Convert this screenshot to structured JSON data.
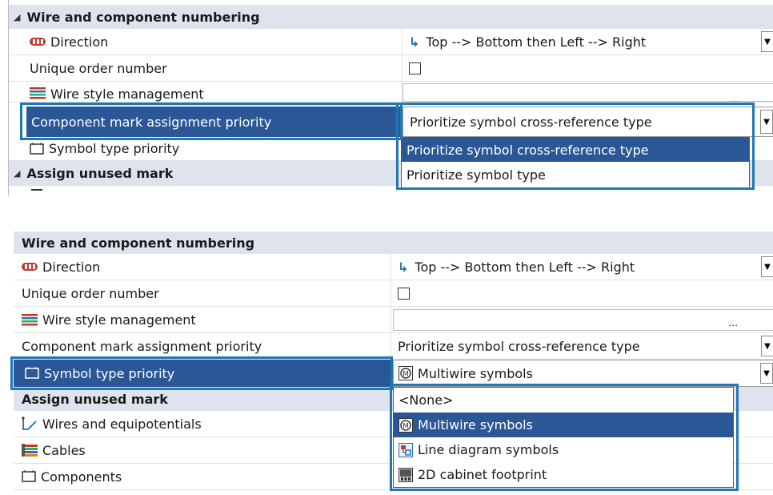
{
  "panel1": {
    "header": "Wire and component numbering",
    "rows": {
      "direction": {
        "label": "Direction",
        "value": "Top --> Bottom then Left --> Right"
      },
      "unique_order": {
        "label": "Unique order number"
      },
      "wire_style": {
        "label": "Wire style management",
        "button": "..."
      },
      "component_mark": {
        "label": "Component mark assignment priority",
        "value": "Prioritize symbol cross-reference type"
      },
      "symbol_type": {
        "label": "Symbol type priority"
      }
    },
    "header2": "Assign unused mark",
    "dropdown_options": [
      "Prioritize symbol cross-reference type",
      "Prioritize symbol type"
    ]
  },
  "panel2": {
    "header": "Wire and component numbering",
    "rows": {
      "direction": {
        "label": "Direction",
        "value": "Top --> Bottom then Left --> Right"
      },
      "unique_order": {
        "label": "Unique order number"
      },
      "wire_style": {
        "label": "Wire style management",
        "button": "..."
      },
      "component_mark": {
        "label": "Component mark assignment priority",
        "value": "Prioritize symbol cross-reference type"
      },
      "symbol_type": {
        "label": "Symbol type priority",
        "value": "Multiwire symbols"
      }
    },
    "header2": "Assign unused mark",
    "sub_rows": [
      "Wires and equipotentials",
      "Cables",
      "Components"
    ],
    "dropdown_options": [
      "<None>",
      "Multiwire symbols",
      "Line diagram symbols",
      "2D cabinet footprint"
    ]
  },
  "colors": {
    "selection": "#2b5797",
    "highlight_border": "#1f77b4",
    "header_bg": "#dfe3ee"
  },
  "icons": [
    "direction-icon",
    "wire-style-icon",
    "symbol-icon",
    "multiwire-icon",
    "line-diagram-icon",
    "cabinet-footprint-icon",
    "wires-equipotential-icon",
    "cables-icon",
    "components-icon",
    "arrow-down-right-icon",
    "checkbox",
    "dropdown-arrow-icon"
  ]
}
